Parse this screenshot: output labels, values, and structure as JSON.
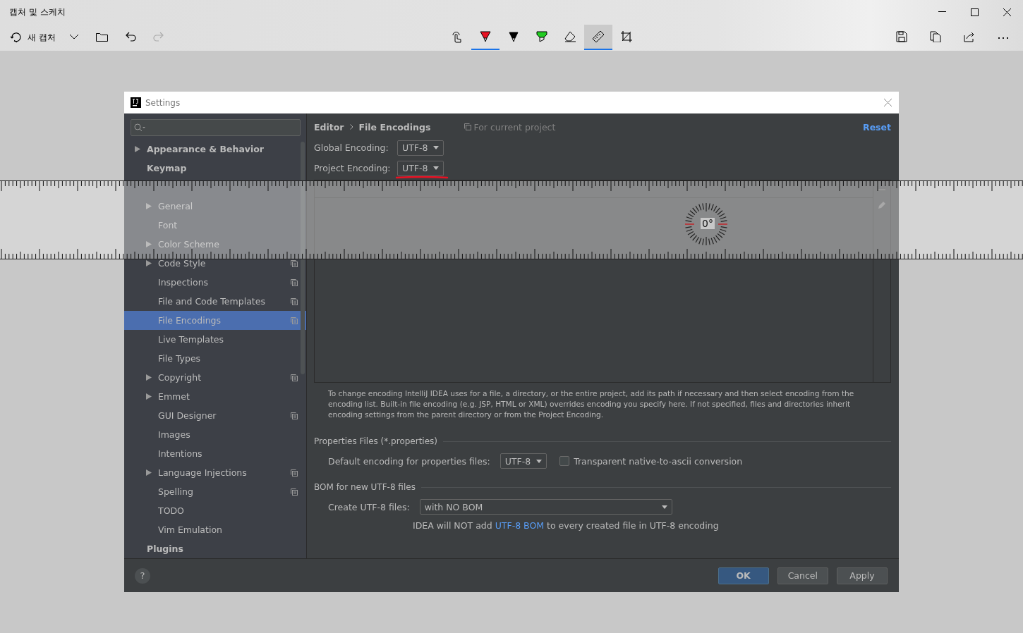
{
  "app": {
    "title": "캡처 및 스케치",
    "new_capture": "새 캡처",
    "more": "⋯"
  },
  "history": [
    {
      "kind": "undo",
      "disabled": false
    },
    {
      "kind": "redo",
      "disabled": true
    }
  ],
  "tools": [
    {
      "kind": "touch",
      "selected": false
    },
    {
      "kind": "pen",
      "color": "#e81123",
      "selected": true
    },
    {
      "kind": "pencil",
      "color": "#000000",
      "selected": false
    },
    {
      "kind": "highlighter",
      "color": "#22cc22",
      "selected": false
    },
    {
      "kind": "eraser",
      "selected": false
    },
    {
      "kind": "ruler",
      "selected": true
    },
    {
      "kind": "crop",
      "selected": false
    }
  ],
  "ruler": {
    "angle": "0°"
  },
  "dialog": {
    "title": "Settings",
    "sidebar": {
      "items": [
        {
          "label": "Appearance & Behavior",
          "expanded": false,
          "selected": false
        },
        {
          "label": "Keymap",
          "selected": false
        },
        {
          "selected": false,
          "children": [
            {
              "label": "General",
              "expanded": false,
              "selected": false
            },
            {
              "label": "Font",
              "selected": false
            },
            {
              "label": "Color Scheme",
              "expanded": false,
              "selected": false
            },
            {
              "label": "Code Style",
              "expanded": false,
              "selected": false,
              "project_scoped": true
            },
            {
              "label": "Inspections",
              "selected": false,
              "project_scoped": true
            },
            {
              "label": "File and Code Templates",
              "selected": false,
              "project_scoped": true
            },
            {
              "label": "File Encodings",
              "selected": true,
              "project_scoped": true
            },
            {
              "label": "Live Templates",
              "selected": false
            },
            {
              "label": "File Types",
              "selected": false
            },
            {
              "label": "Copyright",
              "expanded": false,
              "selected": false,
              "project_scoped": true
            },
            {
              "label": "Emmet",
              "expanded": false,
              "selected": false
            },
            {
              "label": "GUI Designer",
              "selected": false,
              "project_scoped": true
            },
            {
              "label": "Images",
              "selected": false
            },
            {
              "label": "Intentions",
              "selected": false
            },
            {
              "label": "Language Injections",
              "expanded": false,
              "selected": false,
              "project_scoped": true
            },
            {
              "label": "Spelling",
              "selected": false,
              "project_scoped": true
            },
            {
              "label": "TODO",
              "selected": false
            },
            {
              "label": "Vim Emulation",
              "selected": false
            }
          ]
        },
        {
          "label": "Plugins",
          "selected": false
        }
      ]
    },
    "breadcrumb": [
      "Editor",
      "File Encodings"
    ],
    "scope": "For current project",
    "reset": "Reset",
    "encodings": [
      {
        "label": "Global Encoding:",
        "value": "UTF-8"
      },
      {
        "label": "Project Encoding:",
        "value": "UTF-8"
      }
    ],
    "hint": "To change encoding IntelliJ IDEA uses for a file, a directory, or the entire project, add its path if necessary and then select encoding from the encoding list. Built-in file encoding (e.g. JSP, HTML or XML) overrides encoding you specify here. If not specified, files and directories inherit encoding settings from the parent directory or from the Project Encoding.",
    "properties": {
      "title": "Properties Files (*.properties)",
      "label": "Default encoding for properties files:",
      "value": "UTF-8",
      "checkbox": {
        "label": "Transparent native-to-ascii conversion",
        "checked": false
      }
    },
    "bom": {
      "title": "BOM for new UTF-8 files",
      "label": "Create UTF-8 files:",
      "value": "with NO BOM",
      "note_before": "IDEA will NOT add",
      "note_link": "UTF-8 BOM",
      "note_after": "to every created file in UTF-8 encoding"
    },
    "buttons": [
      {
        "label": "OK",
        "primary": true
      },
      {
        "label": "Cancel",
        "primary": false
      },
      {
        "label": "Apply",
        "primary": false
      }
    ],
    "help": "?"
  }
}
